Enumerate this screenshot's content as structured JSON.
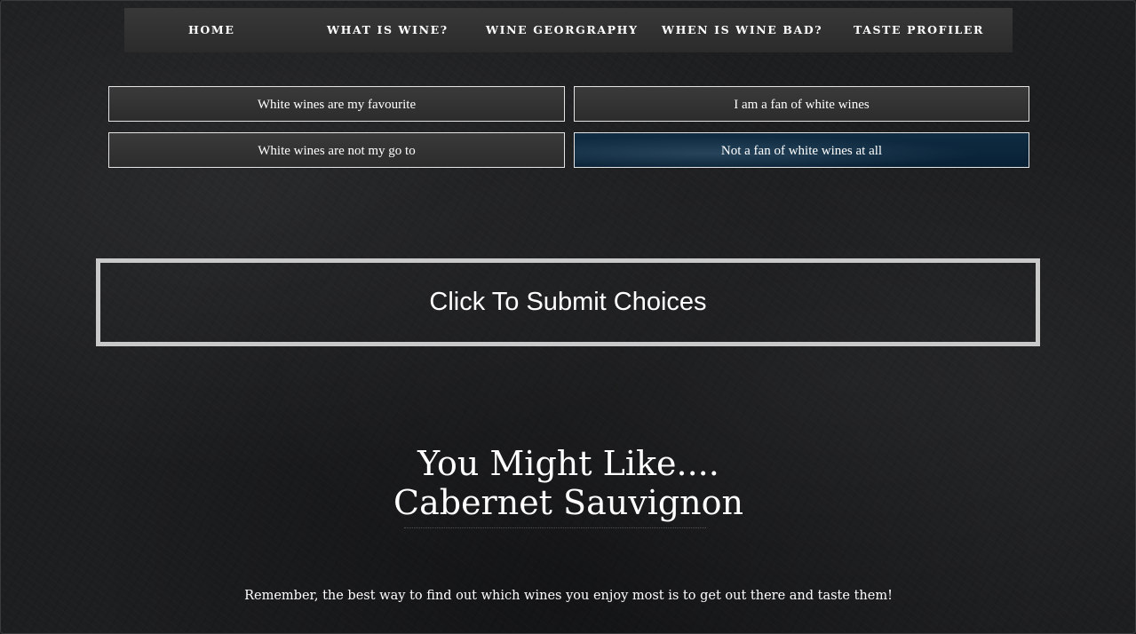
{
  "nav": {
    "items": [
      {
        "label": "HOME"
      },
      {
        "label": "WHAT IS WINE?"
      },
      {
        "label": "WINE GEORGRAPHY"
      },
      {
        "label": "WHEN IS WINE BAD?"
      },
      {
        "label": "TASTE PROFILER"
      }
    ]
  },
  "quiz": {
    "options": [
      {
        "label": "White wines are my favourite",
        "selected": false
      },
      {
        "label": "I am a fan of white wines",
        "selected": false
      },
      {
        "label": "White wines are not my go to",
        "selected": false
      },
      {
        "label": "Not a fan of white wines at all",
        "selected": true
      }
    ],
    "submit_label": "Click To Submit Choices"
  },
  "result": {
    "heading": "You Might Like....",
    "wine": "Cabernet Sauvignon"
  },
  "footer": {
    "note": "Remember, the best way to find out which wines you enjoy most is to get out there and taste them!"
  },
  "colors": {
    "background": "#1d1e20",
    "navbar": "#303030",
    "option_border": "#e6e6e6",
    "selected_option": "#0f2c42",
    "submit_border": "#c9c9c9",
    "text": "#ffffff"
  }
}
